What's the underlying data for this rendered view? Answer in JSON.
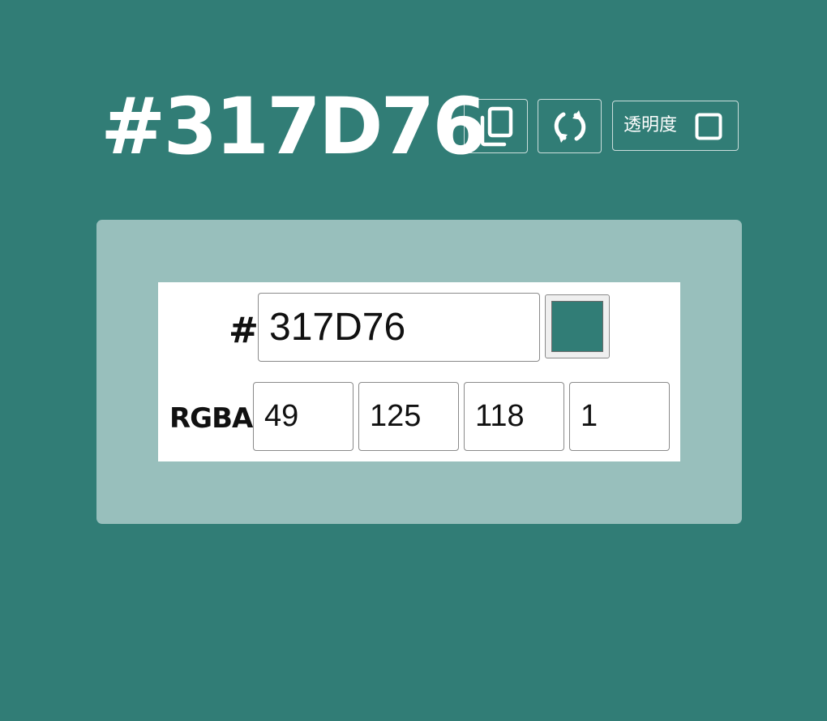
{
  "colors": {
    "background": "#317D76",
    "panel": "#98BFBC",
    "card": "#FFFFFF",
    "swatch": "#317D76",
    "header_text": "#FFFFFF"
  },
  "header": {
    "hex_title": "#317D76",
    "copy_icon": "copy-icon",
    "refresh_icon": "refresh-icon",
    "alpha_label": "透明度",
    "alpha_checkbox_icon": "checkbox-empty-icon"
  },
  "editor": {
    "hash_label": "#",
    "hex_value": "317D76",
    "rgba_label": "RGBA",
    "rgba": {
      "r": "49",
      "g": "125",
      "b": "118",
      "a": "1"
    }
  }
}
